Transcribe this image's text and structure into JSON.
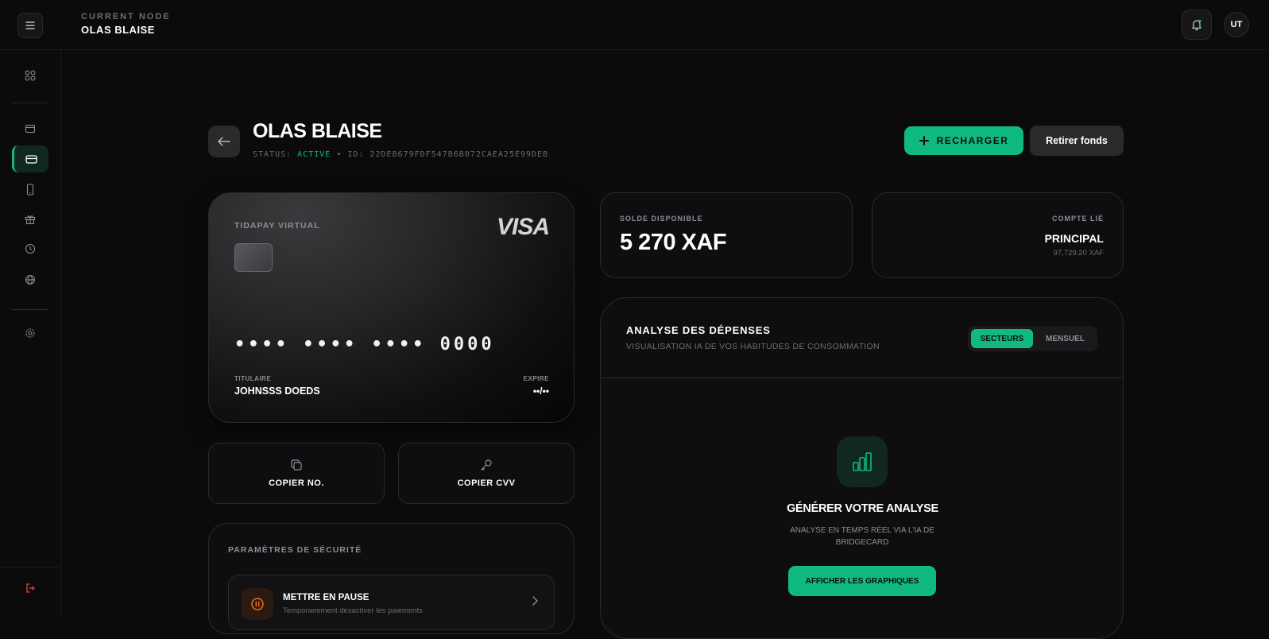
{
  "header": {
    "node_eyebrow": "CURRENT NODE",
    "node_name": "OLAS BLAISE",
    "avatar_initials": "UT",
    "menu_icon": "hamburger-icon",
    "notification_icon": "bell-icon"
  },
  "sidebar": {
    "items": [
      {
        "icon": "dashboard-grid-icon"
      },
      {
        "icon": "wallet-icon"
      },
      {
        "icon": "card-icon",
        "active": true
      },
      {
        "icon": "phone-icon"
      },
      {
        "icon": "gift-icon"
      },
      {
        "icon": "clock-icon"
      },
      {
        "icon": "globe-icon"
      },
      {
        "icon": "settings-icon"
      }
    ],
    "logout_icon": "logout-icon"
  },
  "page": {
    "title": "OLAS BLAISE",
    "status_label": "STATUS: ",
    "status_value": "ACTIVE",
    "id_label": " • ID: 22DEB679FDF547B6B072CAEA25E99DEB",
    "recharge_label": "RECHARGER",
    "withdraw_label": "Retirer fonds"
  },
  "card": {
    "brand": "TIDAPAY VIRTUAL",
    "network": "VISA",
    "number": "•••• •••• •••• 0000",
    "holder_label": "TITULAIRE",
    "holder_name": "JOHNSSS DOEDS",
    "expiry_label": "EXPIRE",
    "expiry_value": "••/••"
  },
  "actions": {
    "copy_number": "COPIER NO.",
    "copy_cvv": "COPIER CVV"
  },
  "security": {
    "title": "PARAMÈTRES DE SÉCURITÉ",
    "pause_title": "METTRE EN PAUSE",
    "pause_sub": "Temporairement désactiver les paiements"
  },
  "balance": {
    "label": "SOLDE DISPONIBLE",
    "value": "5 270 XAF"
  },
  "linked_account": {
    "label": "COMPTE LIÉ",
    "name": "PRINCIPAL",
    "balance": "97,729.20 XAF"
  },
  "analysis": {
    "title": "ANALYSE DES DÉPENSES",
    "subtitle": "VISUALISATION IA DE VOS HABITUDES DE CONSOMMATION",
    "toggle_on": "SECTEURS",
    "toggle_off": "MENSUEL",
    "cta_title": "GÉNÉRER VOTRE ANALYSE",
    "cta_sub": "ANALYSE EN TEMPS RÉEL VIA L'IA DE BRIDGECARD",
    "cta_button": "AFFICHER LES GRAPHIQUES"
  },
  "colors": {
    "accent": "#10b981",
    "background": "#0b0b0c",
    "danger": "#ef4444",
    "warning": "#f97316"
  }
}
